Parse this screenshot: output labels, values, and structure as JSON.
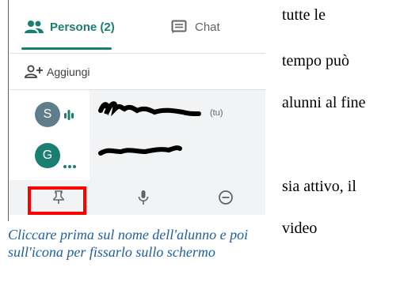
{
  "tabs": {
    "people_label": "Persone (2)",
    "chat_label": "Chat"
  },
  "add": {
    "label": "Aggiungi"
  },
  "participants": [
    {
      "initial": "S",
      "you_tag": "(tu)",
      "avatar_color": "#607d8b"
    },
    {
      "initial": "G",
      "avatar_color": "#1a7e71"
    }
  ],
  "colors": {
    "accent": "#1a7e71",
    "highlight": "#ff0000",
    "caption": "#1f5fa8"
  },
  "icons": {
    "people": "people-icon",
    "chat": "chat-icon",
    "add_person": "add-person-icon",
    "speaking": "speaking-icon",
    "more": "more-dots-icon",
    "pin": "pin-icon",
    "mic": "microphone-icon",
    "remove": "remove-icon"
  },
  "right_text": {
    "line1": "tutte le",
    "line2": "tempo può",
    "line3": "alunni al fine",
    "line4": "sia attivo, il",
    "line5": "video"
  },
  "caption": {
    "text": "Cliccare prima sul nome dell'alunno e poi sull'icona per fissarlo sullo schermo"
  }
}
